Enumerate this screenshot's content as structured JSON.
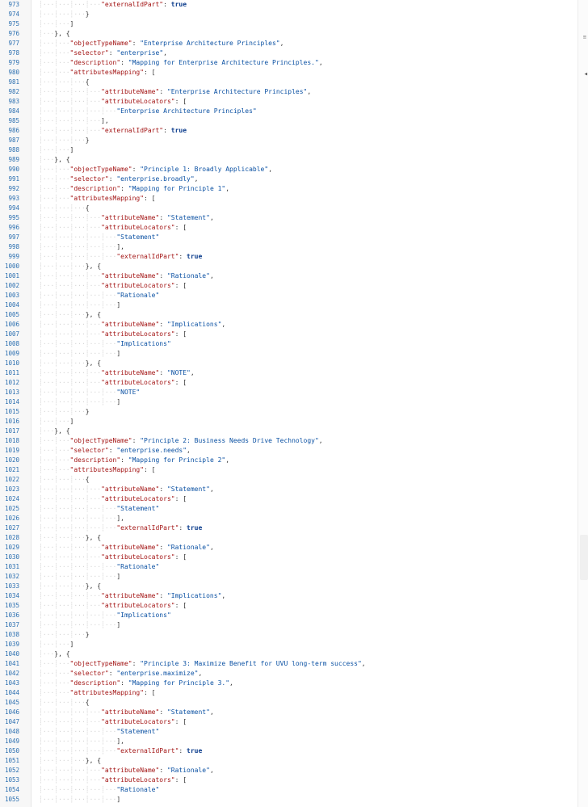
{
  "editor": {
    "lines": [
      {
        "n": "973",
        "indent": 4,
        "segs": [
          [
            "k",
            "\"externalIdPart\""
          ],
          [
            "p",
            ": "
          ],
          [
            "b",
            "true"
          ]
        ]
      },
      {
        "n": "974",
        "indent": 3,
        "segs": [
          [
            "p",
            "}"
          ]
        ]
      },
      {
        "n": "975",
        "indent": 2,
        "segs": [
          [
            "p",
            "]"
          ]
        ]
      },
      {
        "n": "976",
        "indent": 1,
        "segs": [
          [
            "p",
            "}, {"
          ]
        ]
      },
      {
        "n": "977",
        "indent": 2,
        "segs": [
          [
            "k",
            "\"objectTypeName\""
          ],
          [
            "p",
            ": "
          ],
          [
            "s",
            "\"Enterprise Architecture Principles\""
          ],
          [
            "p",
            ","
          ]
        ]
      },
      {
        "n": "978",
        "indent": 2,
        "segs": [
          [
            "k",
            "\"selector\""
          ],
          [
            "p",
            ": "
          ],
          [
            "s",
            "\"enterprise\""
          ],
          [
            "p",
            ","
          ]
        ]
      },
      {
        "n": "979",
        "indent": 2,
        "segs": [
          [
            "k",
            "\"description\""
          ],
          [
            "p",
            ": "
          ],
          [
            "s",
            "\"Mapping for Enterprise Architecture Principles.\""
          ],
          [
            "p",
            ","
          ]
        ]
      },
      {
        "n": "980",
        "indent": 2,
        "segs": [
          [
            "k",
            "\"attributesMapping\""
          ],
          [
            "p",
            ": ["
          ]
        ]
      },
      {
        "n": "981",
        "indent": 3,
        "segs": [
          [
            "p",
            "{"
          ]
        ]
      },
      {
        "n": "982",
        "indent": 4,
        "segs": [
          [
            "k",
            "\"attributeName\""
          ],
          [
            "p",
            ": "
          ],
          [
            "s",
            "\"Enterprise Architecture Principles\""
          ],
          [
            "p",
            ","
          ]
        ]
      },
      {
        "n": "983",
        "indent": 4,
        "segs": [
          [
            "k",
            "\"attributeLocators\""
          ],
          [
            "p",
            ": ["
          ]
        ]
      },
      {
        "n": "984",
        "indent": 5,
        "segs": [
          [
            "s",
            "\"Enterprise Architecture Principles\""
          ]
        ]
      },
      {
        "n": "985",
        "indent": 4,
        "segs": [
          [
            "p",
            "],"
          ]
        ]
      },
      {
        "n": "986",
        "indent": 4,
        "segs": [
          [
            "k",
            "\"externalIdPart\""
          ],
          [
            "p",
            ": "
          ],
          [
            "b",
            "true"
          ]
        ]
      },
      {
        "n": "987",
        "indent": 3,
        "segs": [
          [
            "p",
            "}"
          ]
        ]
      },
      {
        "n": "988",
        "indent": 2,
        "segs": [
          [
            "p",
            "]"
          ]
        ]
      },
      {
        "n": "989",
        "indent": 1,
        "segs": [
          [
            "p",
            "}, {"
          ]
        ]
      },
      {
        "n": "990",
        "indent": 2,
        "segs": [
          [
            "k",
            "\"objectTypeName\""
          ],
          [
            "p",
            ": "
          ],
          [
            "s",
            "\"Principle 1: Broadly Applicable\""
          ],
          [
            "p",
            ","
          ]
        ]
      },
      {
        "n": "991",
        "indent": 2,
        "segs": [
          [
            "k",
            "\"selector\""
          ],
          [
            "p",
            ": "
          ],
          [
            "s",
            "\"enterprise.broadly\""
          ],
          [
            "p",
            ","
          ]
        ]
      },
      {
        "n": "992",
        "indent": 2,
        "segs": [
          [
            "k",
            "\"description\""
          ],
          [
            "p",
            ": "
          ],
          [
            "s",
            "\"Mapping for Principle 1\""
          ],
          [
            "p",
            ","
          ]
        ]
      },
      {
        "n": "993",
        "indent": 2,
        "segs": [
          [
            "k",
            "\"attributesMapping\""
          ],
          [
            "p",
            ": ["
          ]
        ]
      },
      {
        "n": "994",
        "indent": 3,
        "segs": [
          [
            "p",
            "{"
          ]
        ]
      },
      {
        "n": "995",
        "indent": 4,
        "segs": [
          [
            "k",
            "\"attributeName\""
          ],
          [
            "p",
            ": "
          ],
          [
            "s",
            "\"Statement\""
          ],
          [
            "p",
            ","
          ]
        ]
      },
      {
        "n": "996",
        "indent": 4,
        "segs": [
          [
            "k",
            "\"attributeLocators\""
          ],
          [
            "p",
            ": ["
          ]
        ]
      },
      {
        "n": "997",
        "indent": 5,
        "segs": [
          [
            "s",
            "\"Statement\""
          ]
        ]
      },
      {
        "n": "998",
        "indent": 5,
        "segs": [
          [
            "p",
            "],"
          ]
        ]
      },
      {
        "n": "999",
        "indent": 5,
        "segs": [
          [
            "k",
            "\"externalIdPart\""
          ],
          [
            "p",
            ": "
          ],
          [
            "b",
            "true"
          ]
        ]
      },
      {
        "n": "1000",
        "indent": 3,
        "segs": [
          [
            "p",
            "}, {"
          ]
        ]
      },
      {
        "n": "1001",
        "indent": 4,
        "segs": [
          [
            "k",
            "\"attributeName\""
          ],
          [
            "p",
            ": "
          ],
          [
            "s",
            "\"Rationale\""
          ],
          [
            "p",
            ","
          ]
        ]
      },
      {
        "n": "1002",
        "indent": 4,
        "segs": [
          [
            "k",
            "\"attributeLocators\""
          ],
          [
            "p",
            ": ["
          ]
        ]
      },
      {
        "n": "1003",
        "indent": 5,
        "segs": [
          [
            "s",
            "\"Rationale\""
          ]
        ]
      },
      {
        "n": "1004",
        "indent": 5,
        "segs": [
          [
            "p",
            "]"
          ]
        ]
      },
      {
        "n": "1005",
        "indent": 3,
        "segs": [
          [
            "p",
            "}, {"
          ]
        ]
      },
      {
        "n": "1006",
        "indent": 4,
        "segs": [
          [
            "k",
            "\"attributeName\""
          ],
          [
            "p",
            ": "
          ],
          [
            "s",
            "\"Implications\""
          ],
          [
            "p",
            ","
          ]
        ]
      },
      {
        "n": "1007",
        "indent": 4,
        "segs": [
          [
            "k",
            "\"attributeLocators\""
          ],
          [
            "p",
            ": ["
          ]
        ]
      },
      {
        "n": "1008",
        "indent": 5,
        "segs": [
          [
            "s",
            "\"Implications\""
          ]
        ]
      },
      {
        "n": "1009",
        "indent": 5,
        "segs": [
          [
            "p",
            "]"
          ]
        ]
      },
      {
        "n": "1010",
        "indent": 3,
        "segs": [
          [
            "p",
            "}, {"
          ]
        ]
      },
      {
        "n": "1011",
        "indent": 4,
        "segs": [
          [
            "k",
            "\"attributeName\""
          ],
          [
            "p",
            ": "
          ],
          [
            "s",
            "\"NOTE\""
          ],
          [
            "p",
            ","
          ]
        ]
      },
      {
        "n": "1012",
        "indent": 4,
        "segs": [
          [
            "k",
            "\"attributeLocators\""
          ],
          [
            "p",
            ": ["
          ]
        ]
      },
      {
        "n": "1013",
        "indent": 5,
        "segs": [
          [
            "s",
            "\"NOTE\""
          ]
        ]
      },
      {
        "n": "1014",
        "indent": 5,
        "segs": [
          [
            "p",
            "]"
          ]
        ]
      },
      {
        "n": "1015",
        "indent": 3,
        "segs": [
          [
            "p",
            "}"
          ]
        ]
      },
      {
        "n": "1016",
        "indent": 2,
        "segs": [
          [
            "p",
            "]"
          ]
        ]
      },
      {
        "n": "1017",
        "indent": 1,
        "segs": [
          [
            "p",
            "}, {"
          ]
        ]
      },
      {
        "n": "1018",
        "indent": 2,
        "segs": [
          [
            "k",
            "\"objectTypeName\""
          ],
          [
            "p",
            ": "
          ],
          [
            "s",
            "\"Principle 2: Business Needs Drive Technology\""
          ],
          [
            "p",
            ","
          ]
        ]
      },
      {
        "n": "1019",
        "indent": 2,
        "segs": [
          [
            "k",
            "\"selector\""
          ],
          [
            "p",
            ": "
          ],
          [
            "s",
            "\"enterprise.needs\""
          ],
          [
            "p",
            ","
          ]
        ]
      },
      {
        "n": "1020",
        "indent": 2,
        "segs": [
          [
            "k",
            "\"description\""
          ],
          [
            "p",
            ": "
          ],
          [
            "s",
            "\"Mapping for Principle 2\""
          ],
          [
            "p",
            ","
          ]
        ]
      },
      {
        "n": "1021",
        "indent": 2,
        "segs": [
          [
            "k",
            "\"attributesMapping\""
          ],
          [
            "p",
            ": ["
          ]
        ]
      },
      {
        "n": "1022",
        "indent": 3,
        "segs": [
          [
            "p",
            "{"
          ]
        ]
      },
      {
        "n": "1023",
        "indent": 4,
        "segs": [
          [
            "k",
            "\"attributeName\""
          ],
          [
            "p",
            ": "
          ],
          [
            "s",
            "\"Statement\""
          ],
          [
            "p",
            ","
          ]
        ]
      },
      {
        "n": "1024",
        "indent": 4,
        "segs": [
          [
            "k",
            "\"attributeLocators\""
          ],
          [
            "p",
            ": ["
          ]
        ]
      },
      {
        "n": "1025",
        "indent": 5,
        "segs": [
          [
            "s",
            "\"Statement\""
          ]
        ]
      },
      {
        "n": "1026",
        "indent": 5,
        "segs": [
          [
            "p",
            "],"
          ]
        ]
      },
      {
        "n": "1027",
        "indent": 5,
        "segs": [
          [
            "k",
            "\"externalIdPart\""
          ],
          [
            "p",
            ": "
          ],
          [
            "b",
            "true"
          ]
        ]
      },
      {
        "n": "1028",
        "indent": 3,
        "segs": [
          [
            "p",
            "}, {"
          ]
        ]
      },
      {
        "n": "1029",
        "indent": 4,
        "segs": [
          [
            "k",
            "\"attributeName\""
          ],
          [
            "p",
            ": "
          ],
          [
            "s",
            "\"Rationale\""
          ],
          [
            "p",
            ","
          ]
        ]
      },
      {
        "n": "1030",
        "indent": 4,
        "segs": [
          [
            "k",
            "\"attributeLocators\""
          ],
          [
            "p",
            ": ["
          ]
        ]
      },
      {
        "n": "1031",
        "indent": 5,
        "segs": [
          [
            "s",
            "\"Rationale\""
          ]
        ]
      },
      {
        "n": "1032",
        "indent": 5,
        "segs": [
          [
            "p",
            "]"
          ]
        ]
      },
      {
        "n": "1033",
        "indent": 3,
        "segs": [
          [
            "p",
            "}, {"
          ]
        ]
      },
      {
        "n": "1034",
        "indent": 4,
        "segs": [
          [
            "k",
            "\"attributeName\""
          ],
          [
            "p",
            ": "
          ],
          [
            "s",
            "\"Implications\""
          ],
          [
            "p",
            ","
          ]
        ]
      },
      {
        "n": "1035",
        "indent": 4,
        "segs": [
          [
            "k",
            "\"attributeLocators\""
          ],
          [
            "p",
            ": ["
          ]
        ]
      },
      {
        "n": "1036",
        "indent": 5,
        "segs": [
          [
            "s",
            "\"Implications\""
          ]
        ]
      },
      {
        "n": "1037",
        "indent": 5,
        "segs": [
          [
            "p",
            "]"
          ]
        ]
      },
      {
        "n": "1038",
        "indent": 3,
        "segs": [
          [
            "p",
            "}"
          ]
        ]
      },
      {
        "n": "1039",
        "indent": 2,
        "segs": [
          [
            "p",
            "]"
          ]
        ]
      },
      {
        "n": "1040",
        "indent": 1,
        "segs": [
          [
            "p",
            "}, {"
          ]
        ]
      },
      {
        "n": "1041",
        "indent": 2,
        "segs": [
          [
            "k",
            "\"objectTypeName\""
          ],
          [
            "p",
            ": "
          ],
          [
            "s",
            "\"Principle 3: Maximize Benefit for UVU long-term success\""
          ],
          [
            "p",
            ","
          ]
        ]
      },
      {
        "n": "1042",
        "indent": 2,
        "segs": [
          [
            "k",
            "\"selector\""
          ],
          [
            "p",
            ": "
          ],
          [
            "s",
            "\"enterprise.maximize\""
          ],
          [
            "p",
            ","
          ]
        ]
      },
      {
        "n": "1043",
        "indent": 2,
        "segs": [
          [
            "k",
            "\"description\""
          ],
          [
            "p",
            ": "
          ],
          [
            "s",
            "\"Mapping for Principle 3.\""
          ],
          [
            "p",
            ","
          ]
        ]
      },
      {
        "n": "1044",
        "indent": 2,
        "segs": [
          [
            "k",
            "\"attributesMapping\""
          ],
          [
            "p",
            ": ["
          ]
        ]
      },
      {
        "n": "1045",
        "indent": 3,
        "segs": [
          [
            "p",
            "{"
          ]
        ]
      },
      {
        "n": "1046",
        "indent": 4,
        "segs": [
          [
            "k",
            "\"attributeName\""
          ],
          [
            "p",
            ": "
          ],
          [
            "s",
            "\"Statement\""
          ],
          [
            "p",
            ","
          ]
        ]
      },
      {
        "n": "1047",
        "indent": 4,
        "segs": [
          [
            "k",
            "\"attributeLocators\""
          ],
          [
            "p",
            ": ["
          ]
        ]
      },
      {
        "n": "1048",
        "indent": 5,
        "segs": [
          [
            "s",
            "\"Statement\""
          ]
        ]
      },
      {
        "n": "1049",
        "indent": 5,
        "segs": [
          [
            "p",
            "],"
          ]
        ]
      },
      {
        "n": "1050",
        "indent": 5,
        "segs": [
          [
            "k",
            "\"externalIdPart\""
          ],
          [
            "p",
            ": "
          ],
          [
            "b",
            "true"
          ]
        ]
      },
      {
        "n": "1051",
        "indent": 3,
        "segs": [
          [
            "p",
            "}, {"
          ]
        ]
      },
      {
        "n": "1052",
        "indent": 4,
        "segs": [
          [
            "k",
            "\"attributeName\""
          ],
          [
            "p",
            ": "
          ],
          [
            "s",
            "\"Rationale\""
          ],
          [
            "p",
            ","
          ]
        ]
      },
      {
        "n": "1053",
        "indent": 4,
        "segs": [
          [
            "k",
            "\"attributeLocators\""
          ],
          [
            "p",
            ": ["
          ]
        ]
      },
      {
        "n": "1054",
        "indent": 5,
        "segs": [
          [
            "s",
            "\"Rationale\""
          ]
        ]
      },
      {
        "n": "1055",
        "indent": 5,
        "segs": [
          [
            "p",
            "]"
          ]
        ]
      }
    ],
    "colors": {
      "key": "#a31515",
      "string": "#0b51a3",
      "boolean": "#0b3c8c",
      "line_number": "#2b6fb0",
      "punctuation": "#333333",
      "indent_guide": "#d2d2d2"
    },
    "ruler": {
      "marker_icon": "equals-icon",
      "marker_glyph": "≡",
      "cursor_icon": "arrow-left-icon",
      "cursor_glyph": "◂"
    }
  }
}
